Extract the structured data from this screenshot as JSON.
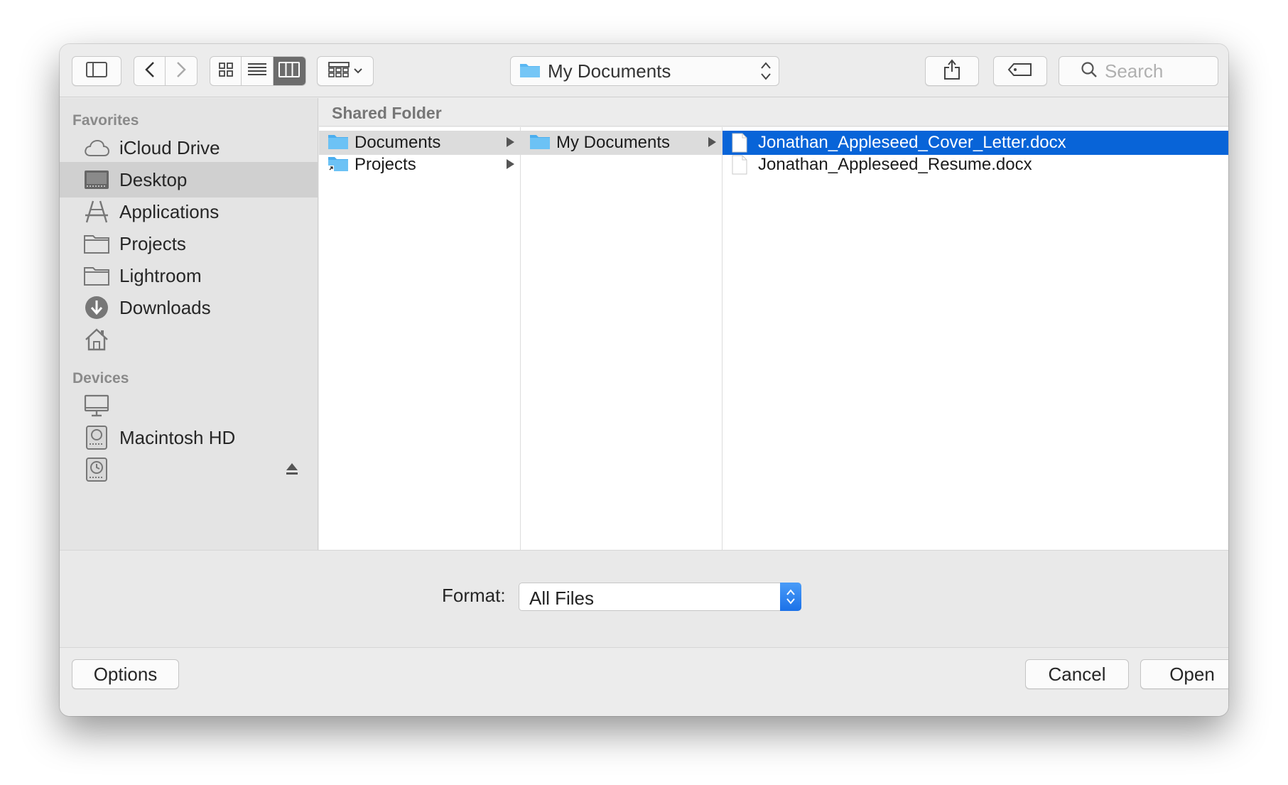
{
  "toolbar": {
    "path_popup_label": "My Documents",
    "search_placeholder": "Search"
  },
  "sidebar": {
    "favorites_header": "Favorites",
    "favorites": [
      {
        "label": "iCloud Drive",
        "icon": "cloud-icon"
      },
      {
        "label": "Desktop",
        "icon": "desktop-icon",
        "selected": true
      },
      {
        "label": "Applications",
        "icon": "applications-icon"
      },
      {
        "label": "Projects",
        "icon": "folder-icon"
      },
      {
        "label": "Lightroom",
        "icon": "folder-icon"
      },
      {
        "label": "Downloads",
        "icon": "downloads-icon"
      },
      {
        "label": "",
        "icon": "home-icon"
      }
    ],
    "devices_header": "Devices",
    "devices": [
      {
        "label": "",
        "icon": "computer-icon"
      },
      {
        "label": "Macintosh HD",
        "icon": "hard-drive-icon"
      },
      {
        "label": "",
        "icon": "time-machine-icon",
        "ejectable": true
      }
    ]
  },
  "browser": {
    "header": "Shared Folder",
    "columns": [
      {
        "items": [
          {
            "label": "Documents",
            "icon": "folder-icon",
            "has_children": true,
            "state": "path"
          },
          {
            "label": "Projects",
            "icon": "folder-alias-icon",
            "has_children": true
          }
        ]
      },
      {
        "items": [
          {
            "label": "My Documents",
            "icon": "folder-icon",
            "has_children": true,
            "state": "path"
          }
        ]
      },
      {
        "items": [
          {
            "label": "Jonathan_Appleseed_Cover_Letter.docx",
            "icon": "document-icon",
            "state": "selected"
          },
          {
            "label": "Jonathan_Appleseed_Resume.docx",
            "icon": "document-icon"
          }
        ]
      }
    ]
  },
  "accessory": {
    "format_label": "Format:",
    "format_value": "All Files"
  },
  "buttons": {
    "options": "Options",
    "cancel": "Cancel",
    "open": "Open"
  },
  "colors": {
    "selection_blue": "#0864d8",
    "folder_blue": "#5ab7f2",
    "window_bg": "#ececec"
  }
}
